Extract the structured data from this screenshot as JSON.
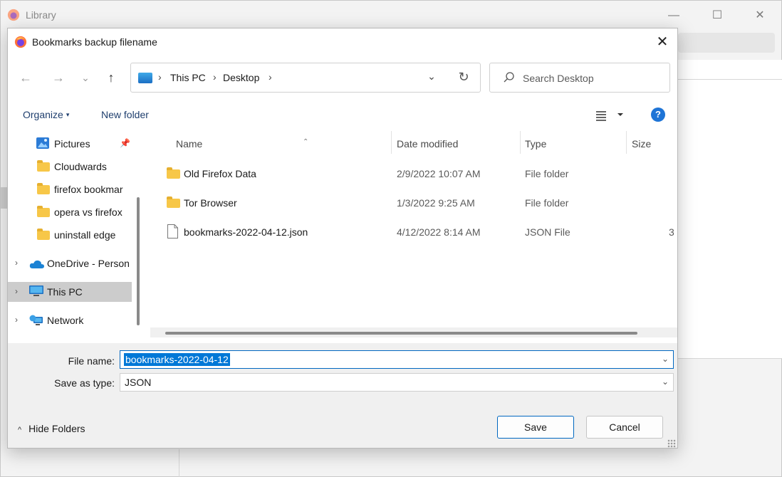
{
  "background_window": {
    "title": "Library",
    "controls": {
      "minimize": "—",
      "maximize": "☐",
      "close": "✕"
    }
  },
  "dialog": {
    "title": "Bookmarks backup filename",
    "close": "✕"
  },
  "nav": {
    "back": "←",
    "forward": "→",
    "recent": "⌄",
    "up": "↑"
  },
  "address": {
    "crumbs": [
      "This PC",
      "Desktop"
    ],
    "sep": "›",
    "dropdown": "⌄",
    "refresh": "↻"
  },
  "search": {
    "placeholder": "Search Desktop"
  },
  "toolbar": {
    "organize": "Organize",
    "organize_caret": "▾",
    "new_folder": "New folder",
    "help": "?"
  },
  "sidebar": {
    "items": [
      {
        "label": "Pictures",
        "icon": "pictures-icon",
        "pinned": true
      },
      {
        "label": "Cloudwards",
        "icon": "folder-icon"
      },
      {
        "label": "firefox bookmar",
        "icon": "folder-icon"
      },
      {
        "label": "opera vs firefox",
        "icon": "folder-icon"
      },
      {
        "label": "uninstall edge",
        "icon": "folder-icon"
      },
      {
        "label": "OneDrive - Person",
        "icon": "onedrive-icon"
      },
      {
        "label": "This PC",
        "icon": "pc-icon",
        "selected": true
      },
      {
        "label": "Network",
        "icon": "network-icon"
      }
    ],
    "chevron": "›",
    "pin": "📌"
  },
  "columns": {
    "name": "Name",
    "date": "Date modified",
    "type": "Type",
    "size": "Size",
    "sort_caret": "⌃"
  },
  "files": [
    {
      "name": "Old Firefox Data",
      "date": "2/9/2022 10:07 AM",
      "type": "File folder",
      "size": "",
      "icon": "folder-icon"
    },
    {
      "name": "Tor Browser",
      "date": "1/3/2022 9:25 AM",
      "type": "File folder",
      "size": "",
      "icon": "folder-icon"
    },
    {
      "name": "bookmarks-2022-04-12.json",
      "date": "4/12/2022 8:14 AM",
      "type": "JSON File",
      "size": "3",
      "icon": "file-icon"
    }
  ],
  "form": {
    "filename_label": "File name:",
    "filename_value": "bookmarks-2022-04-12",
    "type_label": "Save as type:",
    "type_value": "JSON",
    "dropdown": "⌄"
  },
  "footer": {
    "hide_folders": "Hide Folders",
    "hide_caret": "^",
    "save": "Save",
    "cancel": "Cancel"
  },
  "colors": {
    "accent": "#0067c0",
    "selection": "#0078d7",
    "folder": "#f7c748",
    "help": "#1e74d6"
  }
}
